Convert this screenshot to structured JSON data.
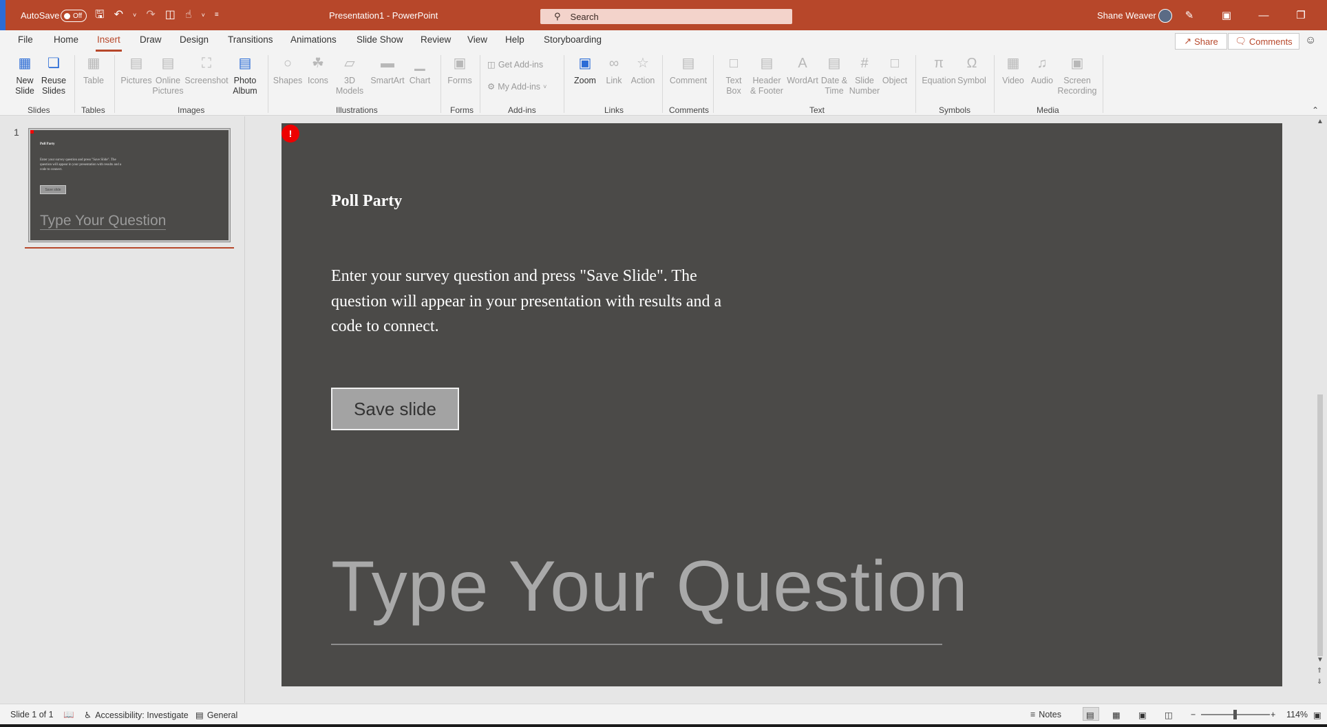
{
  "titlebar": {
    "autosave_label": "AutoSave",
    "autosave_state": "Off",
    "doc_title": "Presentation1  -  PowerPoint",
    "search_placeholder": "Search",
    "user_name": "Shane Weaver",
    "accent_color": "#b7472a"
  },
  "tabs": [
    "File",
    "Home",
    "Insert",
    "Draw",
    "Design",
    "Transitions",
    "Animations",
    "Slide Show",
    "Review",
    "View",
    "Help",
    "Storyboarding"
  ],
  "active_tab": "Insert",
  "share_label": "Share",
  "comments_label": "Comments",
  "ribbon": {
    "slides": {
      "new_slide": "New\nSlide",
      "reuse_slides": "Reuse\nSlides",
      "group": "Slides"
    },
    "tables": {
      "table": "Table",
      "group": "Tables"
    },
    "images": {
      "pictures": "Pictures",
      "online_pictures": "Online\nPictures",
      "screenshot": "Screenshot",
      "photo_album": "Photo\nAlbum",
      "group": "Images"
    },
    "illustrations": {
      "shapes": "Shapes",
      "icons": "Icons",
      "models_3d": "3D\nModels",
      "smartart": "SmartArt",
      "chart": "Chart",
      "group": "Illustrations"
    },
    "forms": {
      "forms": "Forms",
      "group": "Forms"
    },
    "addins": {
      "get_addins": "Get Add-ins",
      "my_addins": "My Add-ins",
      "group": "Add-ins"
    },
    "links": {
      "zoom": "Zoom",
      "link": "Link",
      "action": "Action",
      "group": "Links"
    },
    "comments": {
      "comment": "Comment",
      "group": "Comments"
    },
    "text": {
      "text_box": "Text\nBox",
      "header_footer": "Header\n& Footer",
      "wordart": "WordArt",
      "date_time": "Date &\nTime",
      "slide_number": "Slide\nNumber",
      "object": "Object",
      "group": "Text"
    },
    "symbols": {
      "equation": "Equation",
      "symbol": "Symbol",
      "group": "Symbols"
    },
    "media": {
      "video": "Video",
      "audio": "Audio",
      "screen_recording": "Screen\nRecording",
      "group": "Media"
    }
  },
  "thumbnail": {
    "number": "1",
    "title": "Poll Party",
    "body": "Enter your survey question and press \"Save Slide\". The question will appear in your presentation with results and a code to connect.",
    "button": "Save slide",
    "question": "Type Your Question"
  },
  "slide": {
    "alert": "!",
    "title": "Poll Party",
    "body": "Enter your survey question and press \"Save Slide\". The question will appear in your presentation with results and a code to connect.",
    "button": "Save slide",
    "question": "Type Your Question",
    "background_color": "#4b4a48"
  },
  "status": {
    "slide_count": "Slide 1 of 1",
    "accessibility": "Accessibility: Investigate",
    "sensitivity": "General",
    "notes": "Notes",
    "zoom_level": "114%",
    "zoom_minus": "−",
    "zoom_plus": "+"
  }
}
